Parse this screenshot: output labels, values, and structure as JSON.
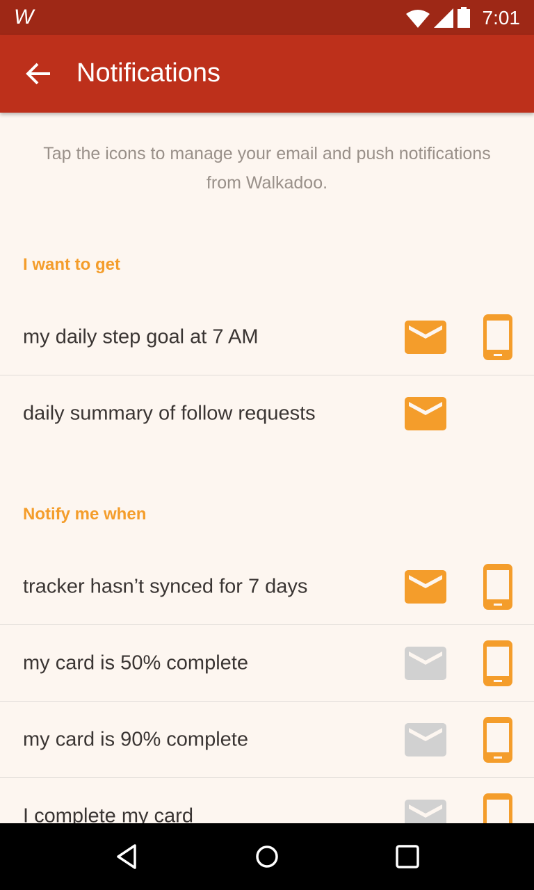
{
  "status_bar": {
    "app_logo": "W",
    "time": "7:01"
  },
  "app_bar": {
    "title": "Notifications",
    "back_icon": "arrow-left-icon"
  },
  "intro_text": "Tap the icons to manage your email and push notifications from Walkadoo.",
  "colors": {
    "accent": "#f49d2b",
    "inactive": "#d1d1d1",
    "app_bar": "#bd301b",
    "status_bar": "#9e2816",
    "background": "#fdf6f0"
  },
  "sections": [
    {
      "header": "I want to get",
      "rows": [
        {
          "label": "my daily step goal at 7 AM",
          "email": "on",
          "push": "on"
        },
        {
          "label": "daily summary of follow requests",
          "email": "on",
          "push": "none"
        }
      ]
    },
    {
      "header": "Notify me when",
      "rows": [
        {
          "label": "tracker hasn’t synced for 7 days",
          "email": "on",
          "push": "on"
        },
        {
          "label": "my card is 50% complete",
          "email": "off",
          "push": "on"
        },
        {
          "label": "my card is 90% complete",
          "email": "off",
          "push": "on"
        },
        {
          "label": "I complete my card",
          "email": "off",
          "push": "on"
        }
      ]
    }
  ],
  "nav_bar": {
    "back": "back-triangle-icon",
    "home": "home-circle-icon",
    "recents": "recents-square-icon"
  }
}
